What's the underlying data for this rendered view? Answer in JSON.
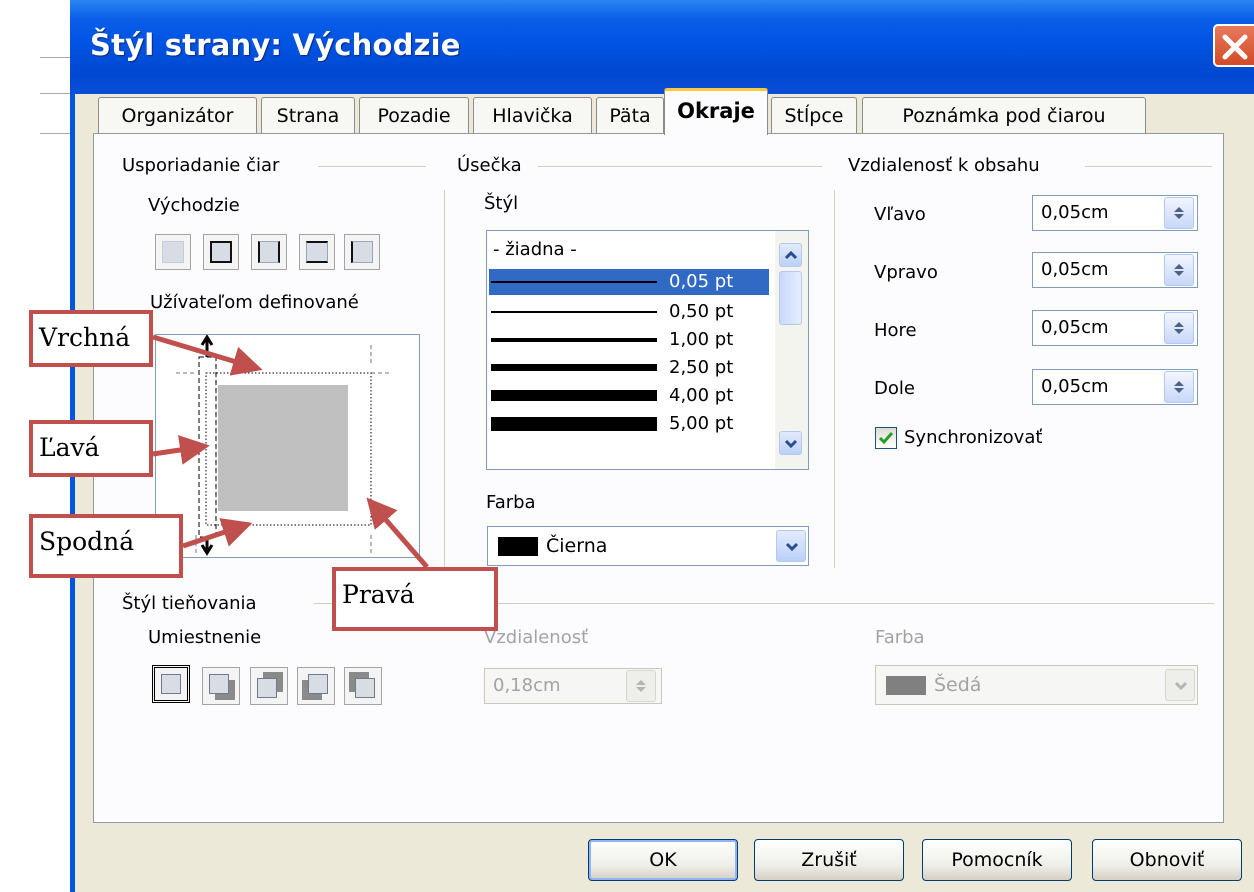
{
  "window": {
    "title": "Štýl strany: Východzie"
  },
  "tabs": [
    {
      "label": "Organizátor"
    },
    {
      "label": "Strana"
    },
    {
      "label": "Pozadie"
    },
    {
      "label": "Hlavička"
    },
    {
      "label": "Päta"
    },
    {
      "label": "Okraje",
      "active": true
    },
    {
      "label": "Stĺpce"
    },
    {
      "label": "Poznámka pod čiarou"
    }
  ],
  "line_arrangement": {
    "heading": "Usporiadanie čiar",
    "default_label": "Východzie",
    "user_defined_label": "Užívateľom definované"
  },
  "line": {
    "heading": "Úsečka",
    "style_label": "Štýl",
    "styles": [
      "- žiadna -",
      "0,05 pt",
      "0,50 pt",
      "1,00 pt",
      "2,50 pt",
      "4,00 pt",
      "5,00 pt"
    ],
    "selected_style": "0,05 pt",
    "color_label": "Farba",
    "color_value": "Čierna",
    "color_swatch": "#000000"
  },
  "spacing": {
    "heading": "Vzdialenosť k obsahu",
    "left_label": "Vľavo",
    "left_value": "0,05cm",
    "right_label": "Vpravo",
    "right_value": "0,05cm",
    "top_label": "Hore",
    "top_value": "0,05cm",
    "bottom_label": "Dole",
    "bottom_value": "0,05cm",
    "sync_label": "Synchronizovať",
    "sync_checked": true
  },
  "shadow": {
    "heading": "Štýl tieňovania",
    "position_label": "Umiestnenie",
    "distance_label": "Vzdialenosť",
    "distance_value": "0,18cm",
    "color_label": "Farba",
    "color_value": "Šedá",
    "color_swatch": "#808080"
  },
  "buttons": {
    "ok": "OK",
    "cancel": "Zrušiť",
    "help": "Pomocník",
    "reset": "Obnoviť"
  },
  "annotations": {
    "top": "Vrchná",
    "left": "Ľavá",
    "bottom": "Spodná",
    "right": "Pravá"
  },
  "colors": {
    "titlebar": "#0054e3",
    "dialog": "#ece9d8",
    "selection": "#316ac5",
    "annotation": "#c0504d"
  }
}
